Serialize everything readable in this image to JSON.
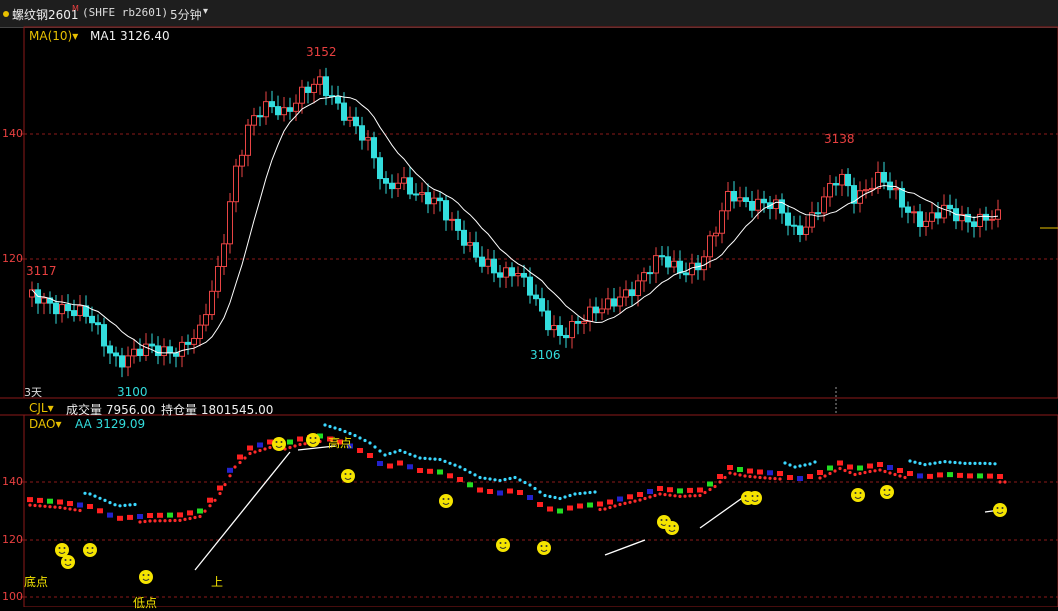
{
  "header": {
    "instrument_name": "螺纹钢2601",
    "marker": "M",
    "code": "(SHFE rb2601)",
    "period": "5分钟",
    "period_arrow": "▾"
  },
  "price_panel": {
    "indicator_name": "MA(10)",
    "indicator_arrow": "▾",
    "ma_label": "MA1 3126.40",
    "y_ticks": [
      "140",
      "120"
    ],
    "period_tag": "3天",
    "extreme_labels": {
      "left_high": "3117",
      "peak": "3152",
      "left_low": "3100",
      "mid_low": "3106",
      "right_high": "3138"
    }
  },
  "volume_panel": {
    "indicator_name": "CJL",
    "indicator_arrow": "▾",
    "volume_label": "成交量 7956.00",
    "oi_label": "持仓量 1801545.00"
  },
  "dao_panel": {
    "indicator_name": "DAO",
    "indicator_arrow": "▾",
    "aa_label": "AA 3129.09",
    "y_ticks": [
      "140",
      "120",
      "100"
    ],
    "annotations": {
      "bottom": "底点",
      "low": "低点",
      "high": "高点",
      "up": "上"
    }
  },
  "colors": {
    "up_candle": "#e84444",
    "down_candle": "#33dddd",
    "ma_line": "#ffffff",
    "grid": "#8b1a1a",
    "dao_red_dots": "#ff2b2b",
    "dao_cyan_dots": "#3bd8ff",
    "smiley": "#f5e400"
  }
}
